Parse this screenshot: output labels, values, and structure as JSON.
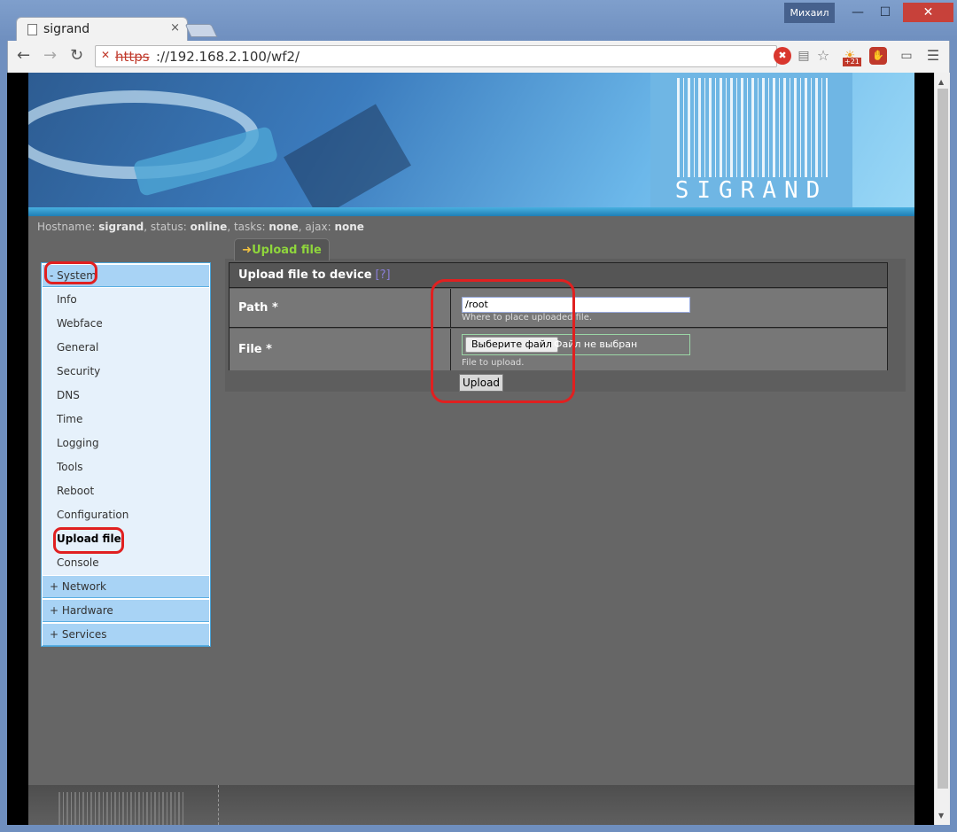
{
  "browser": {
    "tab_title": "sigrand",
    "tab_close": "×",
    "user": "Михаил",
    "url_protocol": "https",
    "url_rest": "://192.168.2.100/wf2/",
    "weather_badge": "+21"
  },
  "status": {
    "hostname_label": "Hostname:",
    "hostname": "sigrand",
    "status_label": ", status:",
    "status": "online",
    "tasks_label": ", tasks:",
    "tasks": "none",
    "ajax_label": ", ajax:",
    "ajax": "none"
  },
  "logo": "SIGRAND",
  "sidebar": {
    "system": "- System",
    "items": [
      "Info",
      "Webface",
      "General",
      "Security",
      "DNS",
      "Time",
      "Logging",
      "Tools",
      "Reboot",
      "Configuration",
      "Upload file",
      "Console"
    ],
    "network": "+ Network",
    "hardware": "+ Hardware",
    "services": "+ Services"
  },
  "content": {
    "tab_label": "Upload file",
    "form_title": "Upload file to device",
    "help": "[?]",
    "path_label": "Path *",
    "path_value": "/root",
    "path_hint": "Where to place uploaded file.",
    "file_label": "File *",
    "file_button": "Выберите файл",
    "file_status": "Файл не выбран",
    "file_hint": "File to upload.",
    "submit": "Upload"
  }
}
